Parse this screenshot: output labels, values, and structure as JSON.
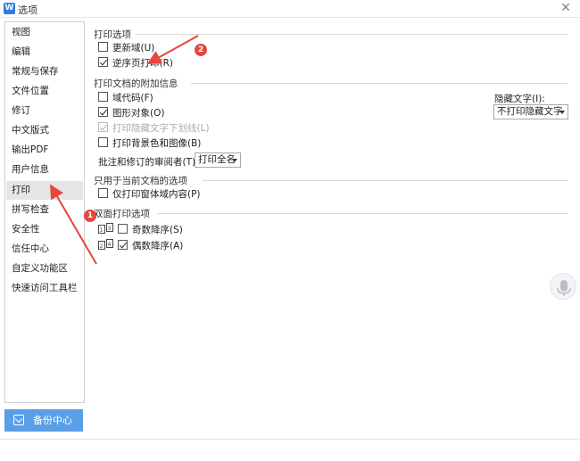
{
  "window": {
    "title": "选项",
    "app_icon": "W"
  },
  "sidebar": {
    "items": [
      {
        "label": "视图"
      },
      {
        "label": "编辑"
      },
      {
        "label": "常规与保存"
      },
      {
        "label": "文件位置"
      },
      {
        "label": "修订"
      },
      {
        "label": "中文版式"
      },
      {
        "label": "输出PDF"
      },
      {
        "label": "用户信息"
      },
      {
        "label": "打印",
        "selected": true
      },
      {
        "label": "拼写检查"
      },
      {
        "label": "安全性"
      },
      {
        "label": "信任中心"
      },
      {
        "label": "自定义功能区"
      },
      {
        "label": "快速访问工具栏"
      }
    ]
  },
  "backup": {
    "label": "备份中心"
  },
  "print_options": {
    "title": "打印选项",
    "update_fields": {
      "label": "更新域(U)",
      "checked": false
    },
    "reverse_order": {
      "label": "逆序页打印(R)",
      "checked": true
    }
  },
  "doc_extra": {
    "title": "打印文档的附加信息",
    "field_codes": {
      "label": "域代码(F)",
      "checked": false
    },
    "drawing_objects": {
      "label": "图形对象(O)",
      "checked": true
    },
    "hidden_underline": {
      "label": "打印隐藏文字下划线(L)",
      "checked": true,
      "disabled": true
    },
    "background": {
      "label": "打印背景色和图像(B)",
      "checked": false
    },
    "hidden_text_label": "隐藏文字(I):",
    "hidden_text_value": "不打印隐藏文字",
    "reviewer_label": "批注和修订的审阅者(T):",
    "reviewer_value": "打印全名"
  },
  "current_doc": {
    "title": "只用于当前文档的选项",
    "form_only": {
      "label": "仅打印窗体域内容(P)",
      "checked": false
    }
  },
  "duplex": {
    "title": "双面打印选项",
    "odd": {
      "label": "奇数降序(S)",
      "checked": false
    },
    "even": {
      "label": "偶数降序(A)",
      "checked": true
    }
  },
  "annotations": {
    "badge1": "1",
    "badge2": "2",
    "color": "#e8453c"
  },
  "colors": {
    "accent": "#5a9fe6",
    "selected_bg": "#e5e5e5"
  }
}
